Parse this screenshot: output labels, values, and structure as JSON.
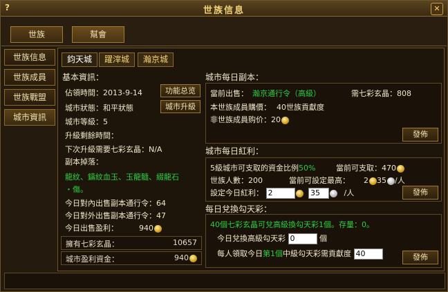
{
  "window": {
    "title": "世族信息",
    "help": "?",
    "close": "✕"
  },
  "top_tabs": [
    {
      "label": "世族"
    },
    {
      "label": "幫會"
    }
  ],
  "left_nav": [
    {
      "label": "世族信息"
    },
    {
      "label": "世族成員"
    },
    {
      "label": "世族戰盟"
    },
    {
      "label": "城市資訊"
    }
  ],
  "city_tabs": [
    {
      "label": "鈞天城"
    },
    {
      "label": "躍滓城"
    },
    {
      "label": "瀚京城"
    }
  ],
  "basic": {
    "header": "基本資訊：",
    "occupy_label": "佔領時間：",
    "occupy_value": "2013-9-14",
    "func_btn": "功能总览",
    "state_label": "城市狀態：",
    "state_value": "和平狀態",
    "upgrade_btn": "城市升級",
    "level_label": "城市等級：",
    "level_value": "5",
    "remain_label": "升級剩餘時間：",
    "need_label": "下次升級需要七彩玄晶：",
    "need_value": "N/A",
    "drop_label": "副本掉落：",
    "drop_items_1": "龍紋、鑄紋血玉、玉龍髓、綴龍石",
    "drop_items_2": "・傷。",
    "sell_in_label": "今日對內出售副本通行令：",
    "sell_in_value": "64",
    "sell_out_label": "今日對外出售副本通行令：",
    "sell_out_value": "47",
    "profit_label": "今日出售盈利：",
    "profit_value": "940",
    "crystal_label": "擁有七彩玄晶：",
    "crystal_value": "10657",
    "fund_label": "城市盈利資金：",
    "fund_value": "940"
  },
  "daily_dungeon": {
    "header": "城市每日副本：",
    "sell_label": "當前出售：",
    "sell_item": "瀚京通行令（高級）",
    "cost_label": "需七彩玄晶：",
    "cost_value": "808",
    "member_label": "本世族成員購價：",
    "member_value": "40世族貢獻度",
    "nonmember_label": "非世族成員购价：",
    "nonmember_value": "20",
    "publish_btn": "發佈"
  },
  "daily_bonus": {
    "header": "城市每日紅利：",
    "ratio_label": "5級城市可支取的資金比例",
    "ratio_value": "50%",
    "avail_label": "當前可支取：",
    "avail_value": "470",
    "count_label": "世族人數：",
    "count_value": "200",
    "max_label": "當前可設定最高：",
    "max_gold": "2",
    "max_silver": "35",
    "per_person": "/人",
    "set_label": "設定今日紅利：",
    "set_gold": "2",
    "set_silver": "35",
    "set_per": "/人",
    "publish_btn": "發佈"
  },
  "exchange": {
    "header": "每日兌換勾天彩：",
    "desc_1": "40個七彩玄晶可兌高級換勾天彩1個。存量：",
    "desc_stock": "0",
    "desc_end": "。",
    "today_label": "今日兌換高級勾天彩",
    "today_value": "0",
    "today_unit": "個",
    "need_prefix": "每人領取今日",
    "need_num": "第1個",
    "need_suffix": "中級勾天彩需貢獻度",
    "need_value": "40",
    "publish_btn": "發佈"
  }
}
